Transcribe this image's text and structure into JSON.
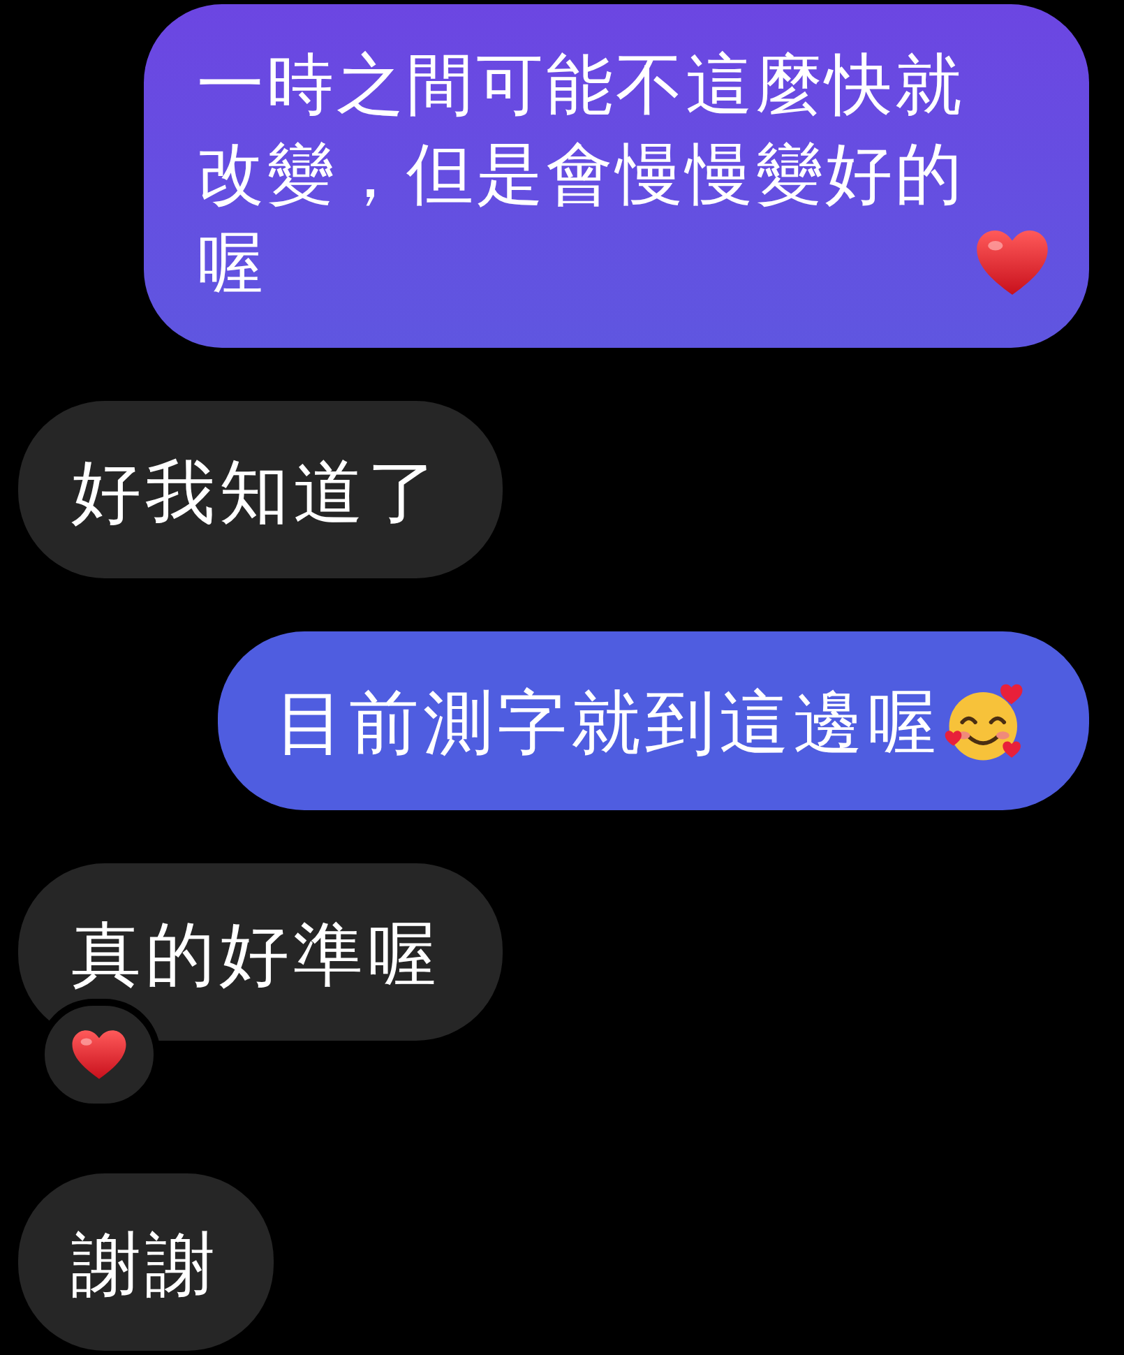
{
  "messages": [
    {
      "kind": "outgoing",
      "text": "一時之間可能不這麼快就改變，但是會慢慢變好的喔",
      "trailing_icon": {
        "kind": "heart"
      }
    },
    {
      "kind": "incoming",
      "text": "好我知道了"
    },
    {
      "kind": "outgoing",
      "text": "目前測字就到這邊喔",
      "trailing_icon": {
        "kind": "smiling-face-with-hearts"
      }
    },
    {
      "kind": "incoming",
      "text": "真的好準喔",
      "reaction": {
        "kind": "heart"
      }
    },
    {
      "kind": "incoming",
      "text": "謝謝"
    }
  ]
}
